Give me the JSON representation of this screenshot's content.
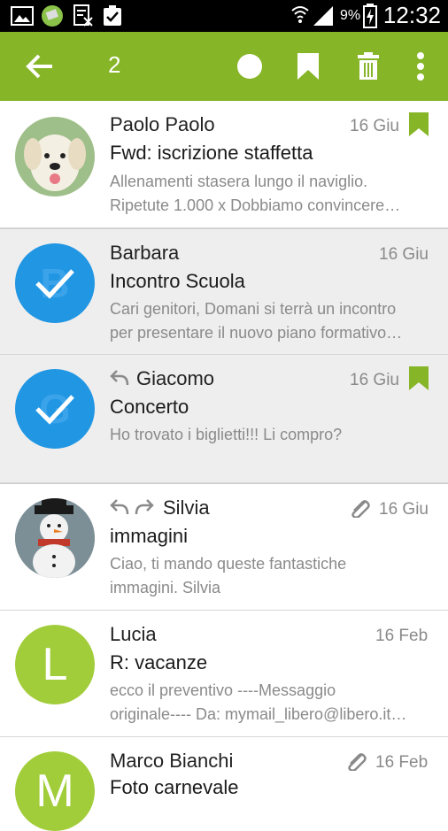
{
  "status_bar": {
    "battery_percent": "9%",
    "time": "12:32"
  },
  "toolbar": {
    "selected_count": "2",
    "accent_color": "#86b527",
    "icons": [
      "back-arrow-icon",
      "mark-read-circle-icon",
      "bookmark-icon",
      "trash-icon",
      "more-vert-icon"
    ]
  },
  "messages": [
    {
      "sender": "Paolo Paolo",
      "subject": "Fwd: iscrizione staffetta",
      "preview_line1": "Allenamenti stasera lungo il naviglio.",
      "preview_line2": "Ripetute 1.000 x Dobbiamo convincere…",
      "date": "16 Giu",
      "flagged": true,
      "selected": false,
      "avatar": "dog-photo"
    },
    {
      "sender": "Barbara",
      "subject": "Incontro Scuola",
      "preview_line1": "Cari genitori, Domani si terrà un incontro",
      "preview_line2": "per presentare il nuovo piano formativo…",
      "date": "16 Giu",
      "flagged": false,
      "selected": true,
      "avatar_letter": "B"
    },
    {
      "sender": "Giacomo",
      "subject": "Concerto",
      "preview_line1": "Ho trovato i biglietti!!! Li compro?",
      "date": "16 Giu",
      "flagged": true,
      "selected": true,
      "replied": true,
      "avatar_letter": "G"
    },
    {
      "sender": "Silvia",
      "subject": "immagini",
      "preview_line1": "Ciao, ti mando queste fantastiche",
      "preview_line2": "immagini. Silvia",
      "date": "16 Giu",
      "replied": true,
      "forwarded": true,
      "attachment": true,
      "avatar": "snowman-photo"
    },
    {
      "sender": "Lucia",
      "subject": "R: vacanze",
      "preview_line1": "ecco il preventivo ----Messaggio",
      "preview_line2": "originale---- Da: mymail_libero@libero.it…",
      "date": "16 Feb",
      "avatar_letter": "L"
    },
    {
      "sender": "Marco Bianchi",
      "subject": "Foto carnevale",
      "date": "16 Feb",
      "attachment": true,
      "avatar_letter": "M"
    }
  ],
  "colors": {
    "selected_avatar": "#2196e3",
    "letter_avatar": "#a2cd3b",
    "flag": "#86b527"
  }
}
